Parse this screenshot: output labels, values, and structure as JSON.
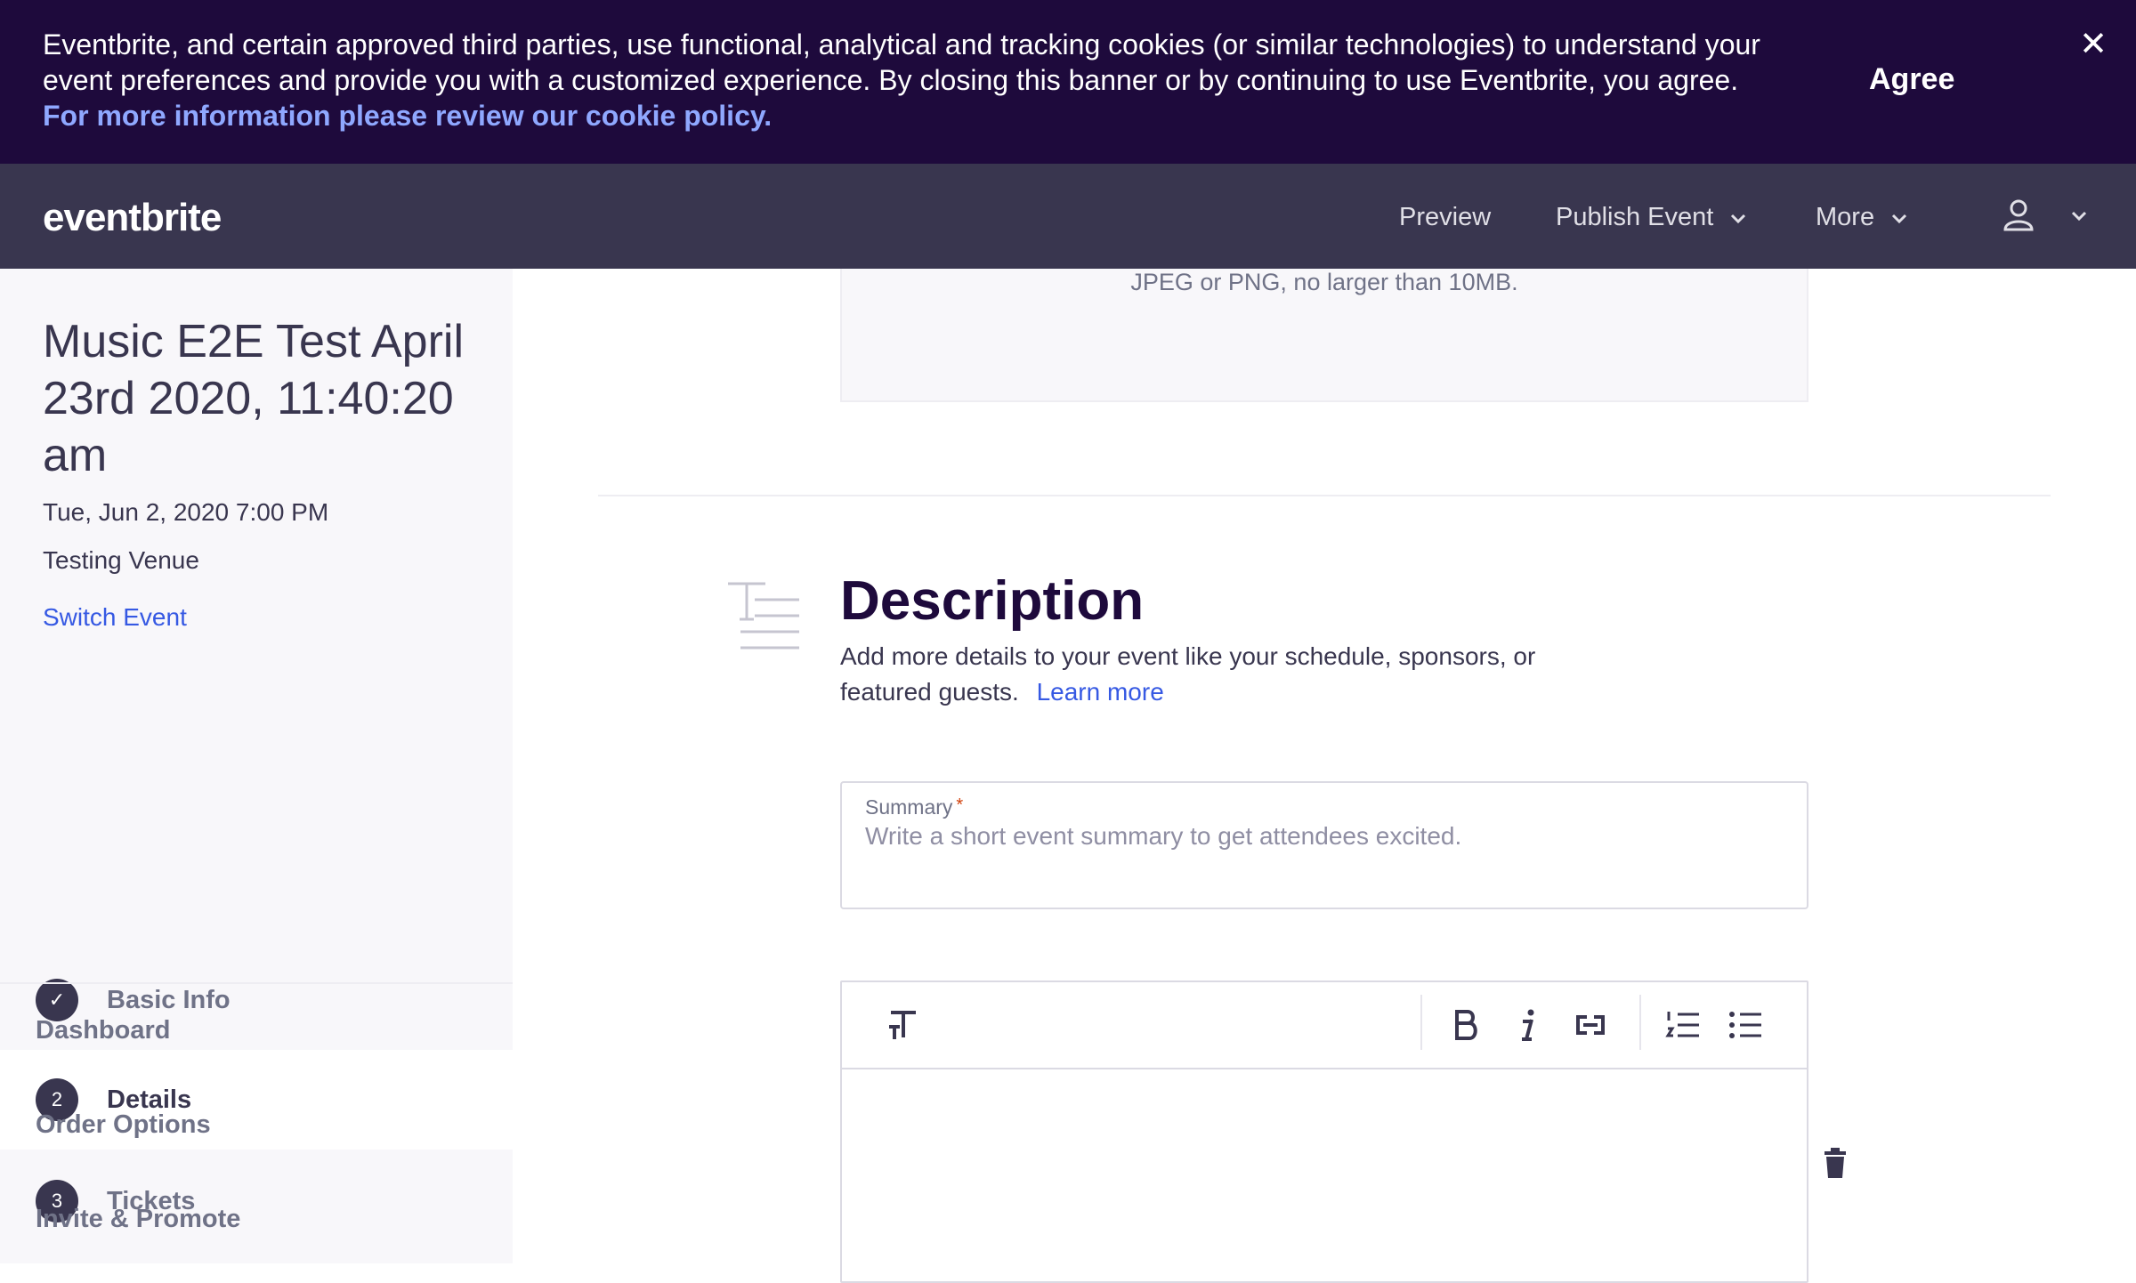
{
  "cookie_banner": {
    "text": "Eventbrite, and certain approved third parties, use functional, analytical and tracking cookies (or similar technologies) to understand your event preferences and provide you with a customized experience. By closing this banner or by continuing to use Eventbrite, you agree.",
    "link_text": "For more information please review our cookie policy.",
    "agree_label": "Agree",
    "close_symbol": "✕"
  },
  "nav": {
    "logo": "eventbrite",
    "preview": "Preview",
    "publish": "Publish Event",
    "more": "More"
  },
  "sidebar": {
    "event_title": "Music E2E Test April 23rd 2020, 11:40:20 am",
    "event_date": "Tue, Jun 2, 2020 7:00 PM",
    "venue": "Testing Venue",
    "switch_event": "Switch Event",
    "steps": [
      {
        "number": "✓",
        "label": "Basic Info"
      },
      {
        "number": "2",
        "label": "Details"
      },
      {
        "number": "3",
        "label": "Tickets"
      }
    ],
    "links": [
      "Dashboard",
      "Order Options",
      "Invite & Promote"
    ]
  },
  "main": {
    "upload_hint": "JPEG or PNG, no larger than 10MB.",
    "description": {
      "title": "Description",
      "text": "Add more details to your event like your schedule, sponsors, or featured guests.",
      "learn_more": "Learn more"
    },
    "summary": {
      "label": "Summary",
      "required_mark": "*",
      "placeholder": "Write a short event summary to get attendees excited.",
      "value": ""
    },
    "editor_toolbar": [
      "text-size-icon",
      "bold-icon",
      "italic-icon",
      "link-icon",
      "numbered-list-icon",
      "bulleted-list-icon"
    ]
  },
  "colors": {
    "banner_bg": "#1e0a3c",
    "nav_bg": "#39364f",
    "link_blue": "#3659e3",
    "sidebar_bg": "#f8f7fa"
  }
}
